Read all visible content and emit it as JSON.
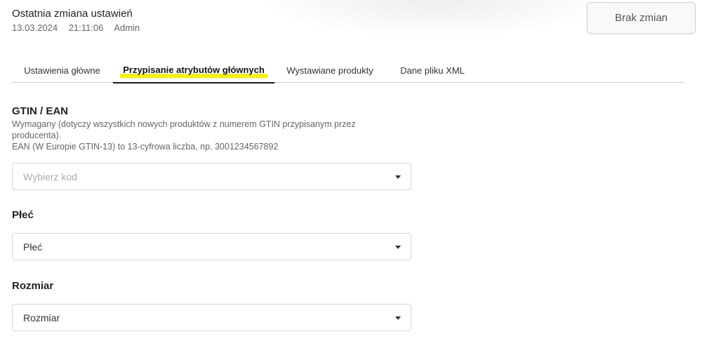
{
  "header": {
    "last_change_title": "Ostatnia zmiana ustawień",
    "date": "13.03.2024",
    "time": "21:11:06",
    "user": "Admin",
    "status_button": "Brak zmian"
  },
  "tabs": [
    {
      "label": "Ustawienia główne"
    },
    {
      "label": "Przypisanie atrybutów głównych",
      "active": true
    },
    {
      "label": "Wystawiane produkty"
    },
    {
      "label": "Dane pliku XML"
    }
  ],
  "gtin": {
    "title": "GTIN / EAN",
    "description_line1": "Wymagany (dotyczy wszystkich nowych produktów z numerem GTIN przypisanym przez producenta).",
    "description_line2": "EAN (W Europie GTIN-13) to 13-cyfrowa liczba, np. 3001234567892",
    "placeholder": "Wybierz kod"
  },
  "gender": {
    "title": "Płeć",
    "value": "Płeć"
  },
  "size": {
    "title": "Rozmiar",
    "value": "Rozmiar"
  },
  "colors": {
    "highlight": "#f5f200",
    "active_underline": "#1a1a1a"
  }
}
